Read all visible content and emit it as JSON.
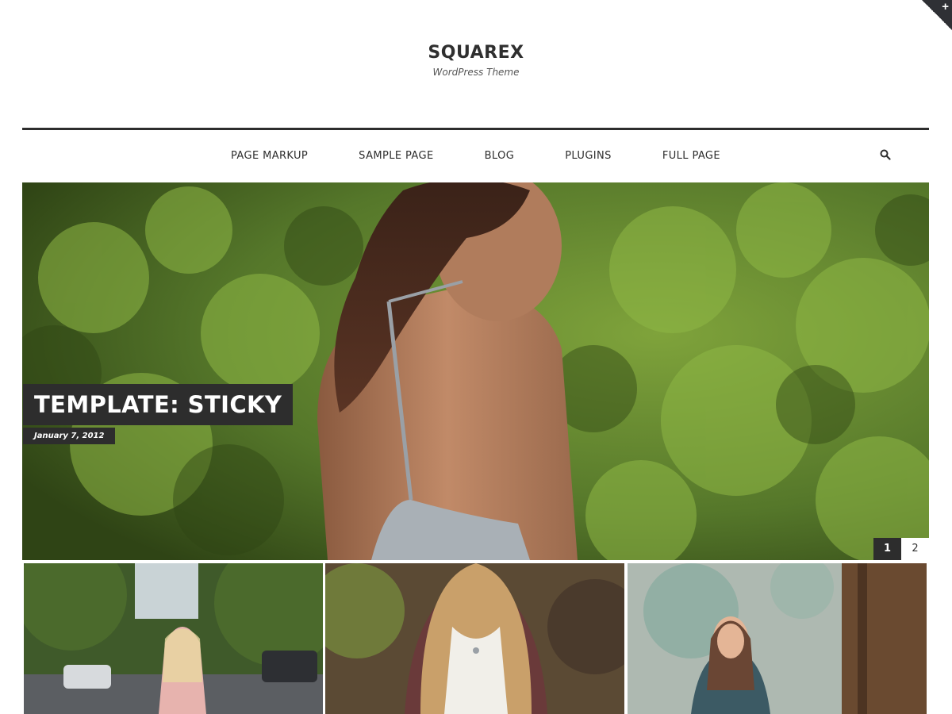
{
  "site": {
    "title": "SQUAREX",
    "tagline": "WordPress Theme"
  },
  "corner_toggle": {
    "icon": "plus-icon",
    "glyph": "+"
  },
  "nav": {
    "items": [
      {
        "label": "PAGE MARKUP"
      },
      {
        "label": "SAMPLE PAGE"
      },
      {
        "label": "BLOG"
      },
      {
        "label": "PLUGINS"
      },
      {
        "label": "FULL PAGE"
      }
    ],
    "search_icon": "search-icon"
  },
  "hero": {
    "title": "TEMPLATE: STICKY",
    "date": "January 7, 2012",
    "pager": [
      {
        "label": "1",
        "active": true
      },
      {
        "label": "2",
        "active": false
      }
    ]
  },
  "thumbnails": [
    {
      "name": "post-thumbnail-street"
    },
    {
      "name": "post-thumbnail-tank-top"
    },
    {
      "name": "post-thumbnail-wall"
    }
  ],
  "colors": {
    "dark": "#2d2d2d",
    "foliage": "#5c7d2a",
    "white": "#ffffff"
  }
}
